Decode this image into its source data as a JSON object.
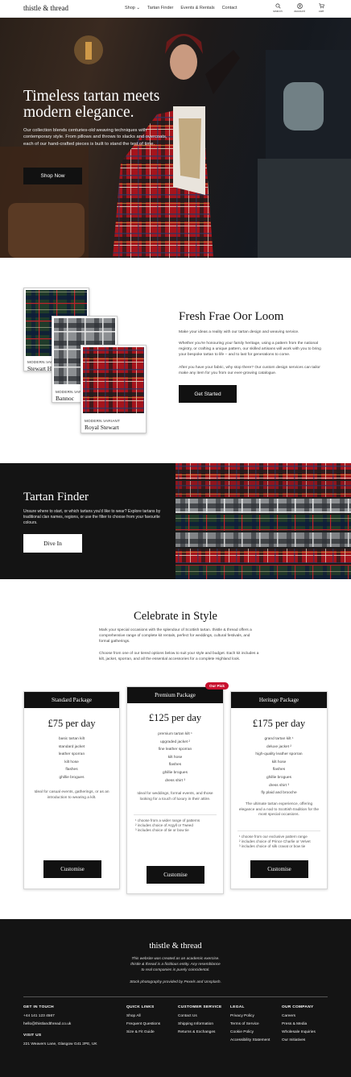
{
  "header": {
    "brand": "thistle & thread",
    "nav": [
      "Shop ⌄",
      "Tartan Finder",
      "Events & Rentals",
      "Contact"
    ],
    "icons": [
      {
        "name": "search-icon",
        "label": "search"
      },
      {
        "name": "account-icon",
        "label": "account"
      },
      {
        "name": "cart-icon",
        "label": "cart"
      }
    ]
  },
  "hero": {
    "title": "Timeless tartan meets modern elegance.",
    "body": "Our collection blends centuries-old weaving techniques with contemporary style. From pillows and throws to slacks and overcoats, each of our hand-crafted pieces is built to stand the test of time.",
    "cta": "Shop Now"
  },
  "loom": {
    "cards": [
      {
        "variant": "MODERN.VARIANT",
        "name": "Stewart H"
      },
      {
        "variant": "MODERN.VARIANT",
        "name": "Bannoc"
      },
      {
        "variant": "MODERN.VARIANT",
        "name": "Royal Stewart"
      }
    ],
    "title": "Fresh Frae Oor Loom",
    "p1": "Make your ideas a reality with our tartan design and weaving service.",
    "p2": "Whether you're honouring your family heritage, using a pattern from the national registry, or crafting a unique pattern, our skilled artisans will work with you to bring your bespoke tartan to life – and to last for generations to come.",
    "p3": "After you have your fabric, why stop there? Our custom design services can tailor make any item for you from our ever-growing catalogue.",
    "cta": "Get Started"
  },
  "finder": {
    "title": "Tartan Finder",
    "body": "Unsure where to start, or which tartans you'd like to wear? Explore tartans by traditional clan names, regions, or use the filter to choose from your favourite colours.",
    "cta": "Dive In"
  },
  "celebrate": {
    "title": "Celebrate in Style",
    "p1": "Mark your special occasions with the splendour of Scottish tartan. thistle & thread offers a comprehensive range of complete kit rentals, perfect for weddings, cultural festivals, and formal gatherings.",
    "p2": "Choose from one of our tiered options below to suit your style and budget. Each kit includes a kilt, jacket, sporran, and all the essential accessories for a complete Highland look.",
    "packages": [
      {
        "name": "Standard Package",
        "price": "£75 per day",
        "items": [
          "basic tartan kilt",
          "standard jacket",
          "leather sporran",
          "kilt hose",
          "flashes",
          "ghillie brogues"
        ],
        "desc": "Ideal for casual events, gatherings, or as an introduction to wearing a kilt.",
        "notes": [],
        "cta": "Customise"
      },
      {
        "name": "Premium Package",
        "badge": "Our Pick",
        "price": "£125 per day",
        "items": [
          "premium tartan kilt ¹",
          "upgraded jacket ²",
          "fine leather sporran",
          "kilt hose",
          "flashes",
          "ghillie brogues",
          "dress shirt ³"
        ],
        "desc": "Ideal for weddings, formal events, and those looking for a touch of luxury in their attire.",
        "notes": [
          "¹ choose from a wider range of patterns",
          "² includes choice of Argyll or Tweed",
          "³ includes choice of tie or bow tie"
        ],
        "cta": "Customise"
      },
      {
        "name": "Heritage Package",
        "price": "£175 per day",
        "items": [
          "grand tartan kilt ¹",
          "deluxe jacket ²",
          "high-quality leather sporran",
          "kilt hose",
          "flashes",
          "ghillie brogues",
          "dress shirt ³",
          "fly plaid and brooche"
        ],
        "desc": "The ultimate tartan experience, offering elegance and a nod to Scottish tradition for the most special occasions.",
        "notes": [
          "¹ choose from our exclusive pattern range",
          "² includes choice of Prince Charlie or Velvet",
          "³ includes choice of silk cravat or bow tie"
        ],
        "cta": "Customise"
      }
    ]
  },
  "footer": {
    "brand": "thistle & thread",
    "disclaimer1": "This website was created as an academic exercise.",
    "disclaimer2": "thistle & thread is a fictitious entity. Any resemblance",
    "disclaimer3": "to real companies is purely coincidental.",
    "credits": "Stock photography provided by Pexels and Unsplash.",
    "contact": {
      "heading": "GET IN TOUCH",
      "phone": "+44 141 123 4567",
      "email": "hello@thistlandthread.co.uk",
      "visit_heading": "VISIT US",
      "address": "221 Weavers Lane, Glasgow G41 2PE, UK"
    },
    "columns": [
      {
        "heading": "QUICK LINKS",
        "links": [
          "Shop All",
          "Frequent Questions",
          "Size & Fit Guide"
        ]
      },
      {
        "heading": "CUSTOMER SERVICE",
        "links": [
          "Contact Us",
          "Shipping Information",
          "Returns & Exchanges"
        ]
      },
      {
        "heading": "LEGAL",
        "links": [
          "Privacy Policy",
          "Terms of Service",
          "Cookie Policy",
          "Accessibility Statement"
        ]
      },
      {
        "heading": "OUR COMPANY",
        "links": [
          "Careers",
          "Press & Media",
          "Wholesale Inquiries",
          "Our Initiatives"
        ]
      }
    ]
  },
  "colors": {
    "dark": "#111111",
    "accent_red": "#c8102e",
    "tartan_red": "#b3121f",
    "tartan_green": "#1f4a2c"
  }
}
